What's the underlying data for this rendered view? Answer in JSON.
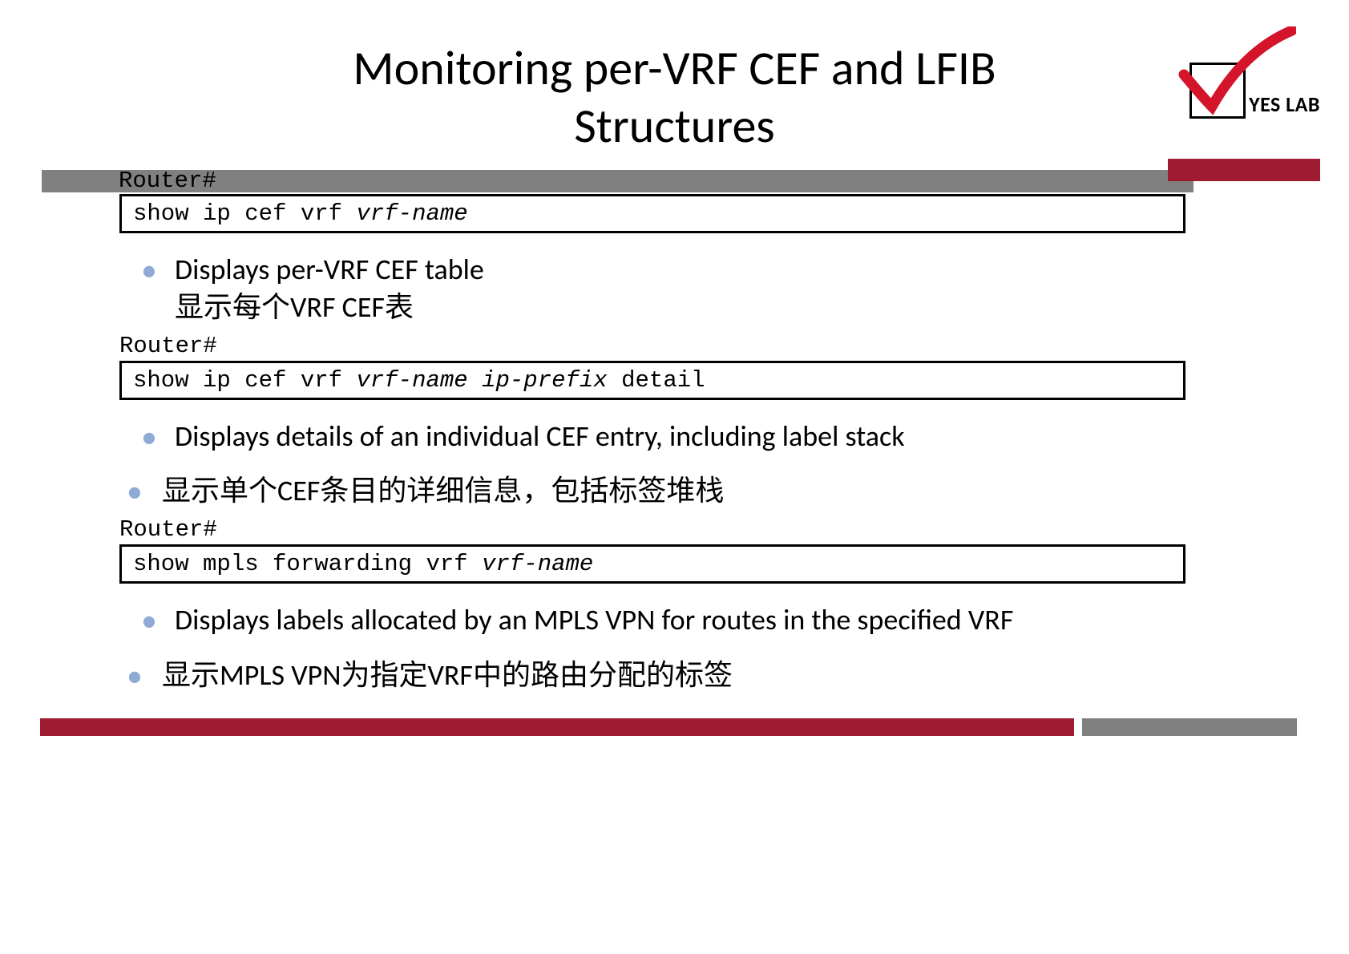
{
  "title_line1": "Monitoring per-VRF CEF and LFIB",
  "title_line2": "Structures",
  "logo_text": "YES LAB",
  "header_prompt_1": "Router#",
  "cmd1_a": "show ip cef vrf ",
  "cmd1_b": "vrf-name",
  "bullet1_en": "Displays per-VRF CEF table",
  "bullet1_zh": "显示每个VRF CEF表",
  "prompt_2": "Router#",
  "cmd2_a": "show ip cef vrf ",
  "cmd2_b": "vrf-name ip-prefix",
  "cmd2_c": " detail",
  "bullet2_en": "Displays details of an individual CEF entry, including label stack",
  "bullet2_zh": "显示单个CEF条目的详细信息，包括标签堆栈",
  "prompt_3": "Router#",
  "cmd3_a": "show mpls forwarding vrf ",
  "cmd3_b": "vrf-name",
  "bullet3_en": "Displays labels allocated by an MPLS VPN for routes in the specified VRF",
  "bullet3_zh": "显示MPLS VPN为指定VRF中的路由分配的标签"
}
